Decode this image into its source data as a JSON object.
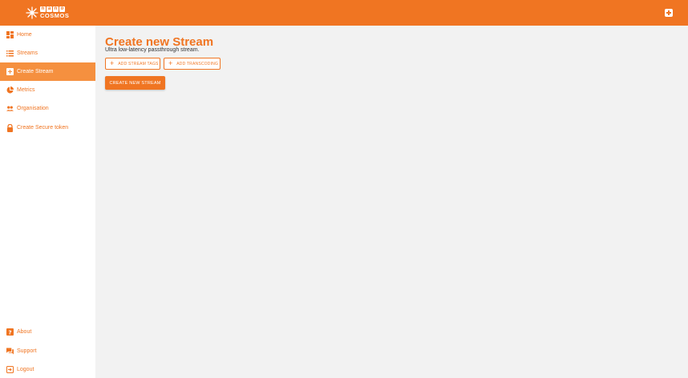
{
  "brand": {
    "nano_letters": [
      "n",
      "a",
      "n",
      "o"
    ],
    "cosmos": "COSMOS",
    "accent": "#f07522"
  },
  "header": {
    "add_icon": "plus-square-icon"
  },
  "sidebar": {
    "items": [
      {
        "label": "Home",
        "icon": "dashboard-icon",
        "active": false
      },
      {
        "label": "Streams",
        "icon": "list-icon",
        "active": false
      },
      {
        "label": "Create Stream",
        "icon": "plus-box-icon",
        "active": true
      },
      {
        "label": "Metrics",
        "icon": "pie-chart-icon",
        "active": false
      },
      {
        "label": "Organisation",
        "icon": "people-icon",
        "active": false
      },
      {
        "label": "Create Secure token",
        "icon": "lock-icon",
        "active": false
      }
    ],
    "bottom_items": [
      {
        "label": "About",
        "icon": "question-icon"
      },
      {
        "label": "Support",
        "icon": "chat-icon"
      },
      {
        "label": "Logout",
        "icon": "logout-icon"
      }
    ]
  },
  "main": {
    "title": "Create new Stream",
    "subtitle": "Ultra low-latency passthrough stream.",
    "add_tags_label": "ADD STREAM TAGS",
    "add_transcoding_label": "ADD TRANSCODING",
    "create_label": "CREATE NEW STREAM"
  }
}
